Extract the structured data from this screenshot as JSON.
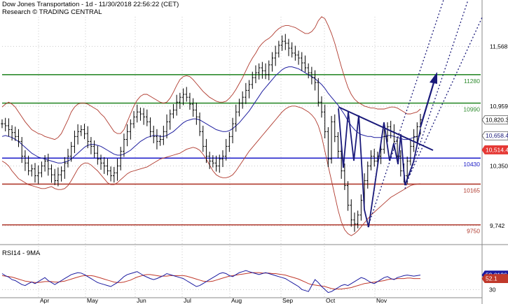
{
  "header": {
    "title": "Dow Jones Transportation - 1d - 11/30/2018 22:56:22 (CET)",
    "subtitle": "Research © TRADING CENTRAL"
  },
  "rsi_header": "RSI14 - 9MA",
  "colors": {
    "price": "#000000",
    "bollinger": "#b03a2e",
    "ma": "#2020a0",
    "resistance": "#2e8b2e",
    "support_blue": "#1a1ac8",
    "support_red": "#b03a2e",
    "trend": "#1a1a7a",
    "rsi": "#1a1aa0",
    "rsi_ma": "#c0392b",
    "grid": "#c8c8c8"
  },
  "chart_data": [
    {
      "type": "line",
      "panel": "price",
      "title": "Dow Jones Transportation - 1d - 11/30/2018 22:56:22 (CET)",
      "x_labels": [
        "Apr",
        "May",
        "Jun",
        "Jul",
        "Aug",
        "Sep",
        "Oct",
        "Nov"
      ],
      "y_ticks": [
        "11,568",
        "10,959",
        "10,350",
        "9,742"
      ],
      "y_tick_values": [
        11568,
        10959,
        10350,
        9742
      ],
      "ylim": [
        9620,
        11870
      ],
      "levels": [
        {
          "label": "11280",
          "value": 11280,
          "color": "#2e8b2e"
        },
        {
          "label": "10990",
          "value": 10990,
          "color": "#2e8b2e"
        },
        {
          "label": "10430",
          "value": 10430,
          "color": "#1a1ac8"
        },
        {
          "label": "10165",
          "value": 10165,
          "color": "#b03a2e"
        },
        {
          "label": "9750",
          "value": 9750,
          "color": "#b03a2e"
        }
      ],
      "price_tags": [
        {
          "label": "10,820.3",
          "value": 10820,
          "bg": "#ffffff",
          "fg": "#000000"
        },
        {
          "label": "10,658.4",
          "value": 10658,
          "bg": "#ffffff",
          "fg": "#1a1a7a"
        },
        {
          "label": "10,514.4",
          "value": 10514,
          "bg": "#e53935",
          "fg": "#ffffff"
        }
      ],
      "series": [
        {
          "kind": "close",
          "values": [
            10780,
            10760,
            10720,
            10690,
            10650,
            10600,
            10450,
            10380,
            10300,
            10320,
            10250,
            10280,
            10350,
            10400,
            10320,
            10260,
            10200,
            10260,
            10300,
            10380,
            10450,
            10550,
            10650,
            10700,
            10720,
            10680,
            10600,
            10550,
            10480,
            10420,
            10380,
            10350,
            10300,
            10250,
            10280,
            10350,
            10500,
            10620,
            10700,
            10780,
            10850,
            10900,
            10880,
            10850,
            10800,
            10700,
            10650,
            10600,
            10620,
            10700,
            10800,
            10880,
            10920,
            11000,
            11050,
            11080,
            11050,
            10980,
            10920,
            10850,
            10700,
            10550,
            10450,
            10400,
            10380,
            10350,
            10420,
            10450,
            10550,
            10650,
            10780,
            10900,
            10990,
            11050,
            11120,
            11180,
            11250,
            11300,
            11350,
            11320,
            11280,
            11380,
            11450,
            11500,
            11580,
            11620,
            11600,
            11550,
            11500,
            11480,
            11450,
            11400,
            11350,
            11300,
            11250,
            11200,
            11000,
            10900,
            10700,
            10420,
            10800,
            10650,
            10500,
            10300,
            10150,
            9950,
            9800,
            9760,
            9850,
            10000,
            10200,
            10350,
            10450,
            10400,
            10450,
            10520,
            10650,
            10750,
            10700,
            10600,
            10450,
            10300,
            10250,
            10400,
            10550,
            10650,
            10750,
            10820
          ]
        },
        {
          "kind": "ma",
          "values": [
            10650,
            10660,
            10650,
            10640,
            10620,
            10600,
            10570,
            10540,
            10510,
            10480,
            10460,
            10440,
            10430,
            10420,
            10410,
            10400,
            10390,
            10380,
            10380,
            10390,
            10400,
            10420,
            10450,
            10480,
            10510,
            10540,
            10560,
            10570,
            10570,
            10560,
            10550,
            10530,
            10510,
            10490,
            10470,
            10460,
            10460,
            10470,
            10490,
            10510,
            10540,
            10570,
            10600,
            10620,
            10640,
            10650,
            10660,
            10660,
            10650,
            10650,
            10660,
            10680,
            10700,
            10730,
            10760,
            10790,
            10810,
            10820,
            10830,
            10830,
            10820,
            10800,
            10780,
            10760,
            10740,
            10720,
            10710,
            10700,
            10700,
            10710,
            10730,
            10760,
            10790,
            10830,
            10870,
            10910,
            10960,
            11010,
            11060,
            11110,
            11150,
            11190,
            11230,
            11270,
            11300,
            11330,
            11350,
            11360,
            11360,
            11350,
            11340,
            11320,
            11300,
            11280,
            11260,
            11240,
            11210,
            11180,
            11140,
            11090,
            11050,
            11010,
            10970,
            10920,
            10870,
            10810,
            10760,
            10720,
            10690,
            10670,
            10660,
            10650,
            10650,
            10640,
            10640,
            10640,
            10650,
            10660,
            10660,
            10650,
            10640,
            10630,
            10620,
            10620,
            10630,
            10640,
            10650,
            10658
          ]
        },
        {
          "kind": "bollinger_upper",
          "values": [
            10950,
            10980,
            11000,
            10980,
            10950,
            10900,
            10850,
            10800,
            10760,
            10720,
            10700,
            10680,
            10670,
            10650,
            10640,
            10630,
            10620,
            10640,
            10680,
            10750,
            10820,
            10900,
            10950,
            10980,
            10990,
            10990,
            10980,
            10960,
            10940,
            10920,
            10880,
            10850,
            10800,
            10750,
            10700,
            10680,
            10680,
            10720,
            10800,
            10880,
            10960,
            11020,
            11060,
            11080,
            11080,
            11060,
            11040,
            11020,
            11000,
            10990,
            11000,
            11040,
            11100,
            11170,
            11230,
            11260,
            11270,
            11260,
            11230,
            11190,
            11150,
            11110,
            11080,
            11050,
            11030,
            11010,
            11000,
            11000,
            11010,
            11040,
            11080,
            11130,
            11190,
            11250,
            11320,
            11390,
            11450,
            11500,
            11560,
            11600,
            11630,
            11650,
            11680,
            11720,
            11750,
            11770,
            11780,
            11780,
            11770,
            11760,
            11740,
            11720,
            11700,
            11700,
            11720,
            11760,
            11830,
            11870,
            11850,
            11780,
            11700,
            11600,
            11480,
            11360,
            11250,
            11150,
            11080,
            11030,
            11000,
            10980,
            10960,
            10950,
            10940,
            10940,
            10930,
            10930,
            10930,
            10940,
            10950,
            10950,
            10940,
            10920,
            10900,
            10880,
            10880,
            10890,
            10900,
            10930
          ]
        },
        {
          "kind": "bollinger_lower",
          "values": [
            10400,
            10380,
            10350,
            10300,
            10260,
            10220,
            10200,
            10180,
            10160,
            10150,
            10140,
            10130,
            10120,
            10120,
            10130,
            10140,
            10120,
            10110,
            10110,
            10120,
            10150,
            10200,
            10260,
            10320,
            10360,
            10380,
            10380,
            10360,
            10330,
            10300,
            10260,
            10220,
            10180,
            10160,
            10160,
            10180,
            10210,
            10240,
            10270,
            10290,
            10300,
            10310,
            10320,
            10330,
            10340,
            10360,
            10380,
            10400,
            10420,
            10430,
            10440,
            10450,
            10460,
            10470,
            10480,
            10500,
            10520,
            10530,
            10540,
            10530,
            10510,
            10470,
            10420,
            10360,
            10300,
            10260,
            10240,
            10230,
            10230,
            10240,
            10260,
            10300,
            10350,
            10400,
            10450,
            10500,
            10540,
            10580,
            10620,
            10660,
            10700,
            10740,
            10780,
            10820,
            10860,
            10900,
            10930,
            10950,
            10960,
            10960,
            10950,
            10940,
            10920,
            10900,
            10870,
            10830,
            10760,
            10650,
            10500,
            10350,
            10200,
            10050,
            9900,
            9780,
            9700,
            9660,
            9640,
            9660,
            9690,
            9730,
            9770,
            9810,
            9850,
            9880,
            9910,
            9940,
            9970,
            10000,
            10030,
            10050,
            10070,
            10090,
            10110,
            10130,
            10150,
            10160,
            10165,
            10170
          ]
        }
      ]
    },
    {
      "type": "line",
      "panel": "rsi",
      "title": "RSI14 - 9MA",
      "y_ticks": [
        "30"
      ],
      "y_tick_values": [
        30
      ],
      "ylim": [
        15,
        95
      ],
      "price_tags": [
        {
          "label": "59.0126",
          "value": 59,
          "bg": "#1a1aa0",
          "fg": "#ffffff"
        },
        {
          "label": "52.1",
          "value": 52,
          "bg": "#c0392b",
          "fg": "#ffffff"
        }
      ],
      "series": [
        {
          "kind": "rsi",
          "values": [
            62,
            58,
            55,
            50,
            48,
            44,
            40,
            38,
            42,
            45,
            42,
            46,
            50,
            54,
            48,
            44,
            40,
            44,
            48,
            52,
            56,
            60,
            62,
            64,
            63,
            60,
            56,
            52,
            48,
            44,
            42,
            40,
            38,
            36,
            40,
            44,
            50,
            56,
            60,
            62,
            64,
            66,
            62,
            58,
            55,
            52,
            50,
            52,
            55,
            58,
            62,
            60,
            58,
            56,
            54,
            52,
            48,
            44,
            40,
            36,
            38,
            42,
            46,
            50,
            54,
            58,
            62,
            64,
            62,
            58,
            56,
            60,
            64,
            66,
            68,
            66,
            64,
            62,
            60,
            62,
            64,
            62,
            60,
            58,
            56,
            54,
            52,
            48,
            44,
            40,
            36,
            30,
            28,
            26,
            38,
            50,
            44,
            36,
            30,
            24,
            26,
            30,
            34,
            38,
            40,
            38,
            42,
            46,
            50,
            54,
            52,
            48,
            44,
            42,
            46,
            50,
            54,
            56,
            52,
            50,
            54,
            56,
            58,
            59,
            58,
            57,
            58,
            59
          ]
        },
        {
          "kind": "rsi_ma",
          "values": [
            58,
            57,
            56,
            55,
            53,
            51,
            49,
            47,
            46,
            45,
            44,
            44,
            45,
            46,
            46,
            46,
            45,
            45,
            46,
            47,
            49,
            51,
            53,
            55,
            57,
            58,
            58,
            58,
            57,
            55,
            53,
            51,
            49,
            47,
            45,
            44,
            44,
            45,
            47,
            49,
            52,
            55,
            57,
            59,
            60,
            60,
            59,
            58,
            57,
            57,
            57,
            58,
            58,
            58,
            58,
            58,
            57,
            55,
            53,
            51,
            49,
            47,
            46,
            46,
            47,
            49,
            51,
            53,
            55,
            57,
            58,
            59,
            60,
            61,
            62,
            63,
            64,
            64,
            64,
            63,
            63,
            63,
            62,
            62,
            61,
            60,
            59,
            57,
            55,
            53,
            51,
            48,
            45,
            42,
            40,
            39,
            38,
            37,
            36,
            34,
            32,
            31,
            31,
            31,
            32,
            33,
            34,
            36,
            38,
            40,
            42,
            43,
            44,
            45,
            46,
            47,
            48,
            50,
            51,
            51,
            52,
            52,
            52,
            53,
            53,
            52,
            52,
            52
          ]
        }
      ]
    }
  ]
}
